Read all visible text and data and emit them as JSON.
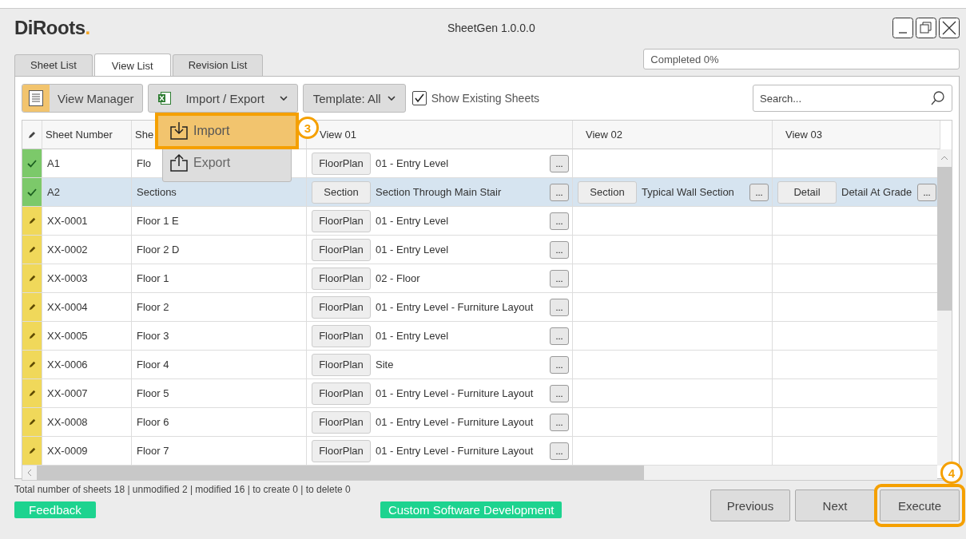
{
  "window": {
    "logo": "DiRoots.",
    "title": "SheetGen 1.0.0.0"
  },
  "tabs": [
    {
      "label": "Sheet List",
      "selected": false
    },
    {
      "label": "View List",
      "selected": true
    },
    {
      "label": "Revision List",
      "selected": false
    }
  ],
  "progress": {
    "label": "Completed 0%",
    "level": 0
  },
  "toolbar": {
    "view_manager": "View Manager",
    "import_export": "Import / Export",
    "template": "Template: All",
    "show_existing": {
      "label": "Show Existing Sheets",
      "checked": true
    },
    "search": {
      "placeholder": "Search..."
    }
  },
  "import_export_menu": [
    {
      "label": "Import",
      "kind": "import",
      "selected": true,
      "callout": "3"
    },
    {
      "label": "Export",
      "kind": "export",
      "selected": false
    }
  ],
  "table": {
    "columns": [
      "Sheet Number",
      "She",
      "View 01",
      "View 02",
      "View 03"
    ],
    "rows": [
      {
        "kind": "done",
        "selected": false,
        "number": "A1",
        "name": "Flo",
        "views": [
          {
            "type": "FloorPlan",
            "name": "01 - Entry Level",
            "browse": "..."
          }
        ]
      },
      {
        "kind": "done",
        "selected": true,
        "number": "A2",
        "name": "Sections",
        "views": [
          {
            "type": "Section",
            "name": "Section Through Main Stair",
            "browse": "..."
          },
          {
            "type": "Section",
            "name": "Typical Wall Section",
            "browse": "..."
          },
          {
            "type": "Detail",
            "name": "Detail At Grade",
            "browse": "..."
          }
        ]
      },
      {
        "kind": "modified",
        "selected": false,
        "number": "XX-0001",
        "name": "Floor 1 E",
        "views": [
          {
            "type": "FloorPlan",
            "name": "01 - Entry Level",
            "browse": "..."
          }
        ]
      },
      {
        "kind": "modified",
        "selected": false,
        "number": "XX-0002",
        "name": "Floor 2 D",
        "views": [
          {
            "type": "FloorPlan",
            "name": "01 - Entry Level",
            "browse": "..."
          }
        ]
      },
      {
        "kind": "modified",
        "selected": false,
        "number": "XX-0003",
        "name": "Floor 1",
        "views": [
          {
            "type": "FloorPlan",
            "name": "02 - Floor",
            "browse": "..."
          }
        ]
      },
      {
        "kind": "modified",
        "selected": false,
        "number": "XX-0004",
        "name": "Floor 2",
        "views": [
          {
            "type": "FloorPlan",
            "name": "01 - Entry Level - Furniture Layout",
            "browse": "..."
          }
        ]
      },
      {
        "kind": "modified",
        "selected": false,
        "number": "XX-0005",
        "name": "Floor 3",
        "views": [
          {
            "type": "FloorPlan",
            "name": "01 - Entry Level",
            "browse": "..."
          }
        ]
      },
      {
        "kind": "modified",
        "selected": false,
        "number": "XX-0006",
        "name": "Floor 4",
        "views": [
          {
            "type": "FloorPlan",
            "name": "Site",
            "browse": "..."
          }
        ]
      },
      {
        "kind": "modified",
        "selected": false,
        "number": "XX-0007",
        "name": "Floor 5",
        "views": [
          {
            "type": "FloorPlan",
            "name": "01 - Entry Level - Furniture Layout",
            "browse": "..."
          }
        ]
      },
      {
        "kind": "modified",
        "selected": false,
        "number": "XX-0008",
        "name": "Floor 6",
        "views": [
          {
            "type": "FloorPlan",
            "name": "01 - Entry Level - Furniture Layout",
            "browse": "..."
          }
        ]
      },
      {
        "kind": "modified",
        "selected": false,
        "number": "XX-0009",
        "name": "Floor 7",
        "views": [
          {
            "type": "FloorPlan",
            "name": "01 - Entry Level - Furniture Layout",
            "browse": "..."
          }
        ]
      }
    ]
  },
  "summary": "Total number of sheets 18 | unmodified 2 | modified 16 | to create 0 | to delete 0",
  "footer": {
    "feedback": "Feedback",
    "custom": "Custom Software Development"
  },
  "buttons": [
    {
      "label": "Previous"
    },
    {
      "label": "Next"
    },
    {
      "label": "Execute",
      "callout": "4"
    }
  ]
}
